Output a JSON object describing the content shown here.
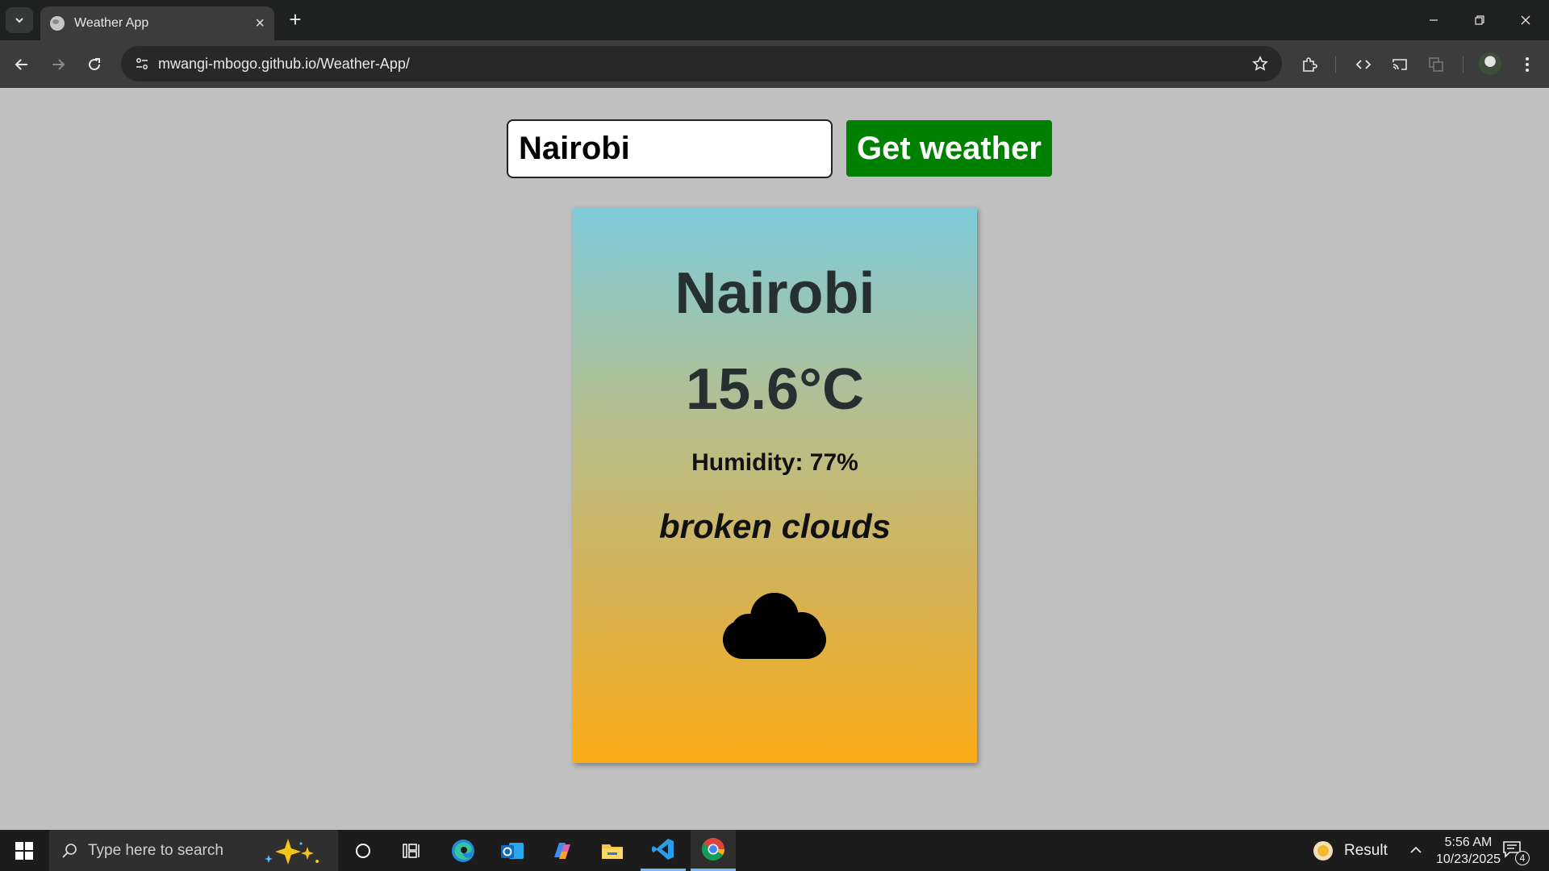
{
  "browser": {
    "tab_title": "Weather App",
    "url": "mwangi-mbogo.github.io/Weather-App/"
  },
  "app": {
    "search_value": "Nairobi",
    "button_label": "Get weather",
    "card": {
      "city": "Nairobi",
      "temperature": "15.6°C",
      "humidity": "Humidity: 77%",
      "description": "broken clouds",
      "icon": "cloud-icon"
    },
    "colors": {
      "button": "#008000",
      "card_gradient_top": "#7ecbdb",
      "card_gradient_bottom": "#faab17",
      "page_background": "#c0c0c0"
    }
  },
  "taskbar": {
    "search_placeholder": "Type here to search",
    "weather_label": "Result",
    "time": "5:56 AM",
    "date": "10/23/2025",
    "notification_count": "4"
  }
}
